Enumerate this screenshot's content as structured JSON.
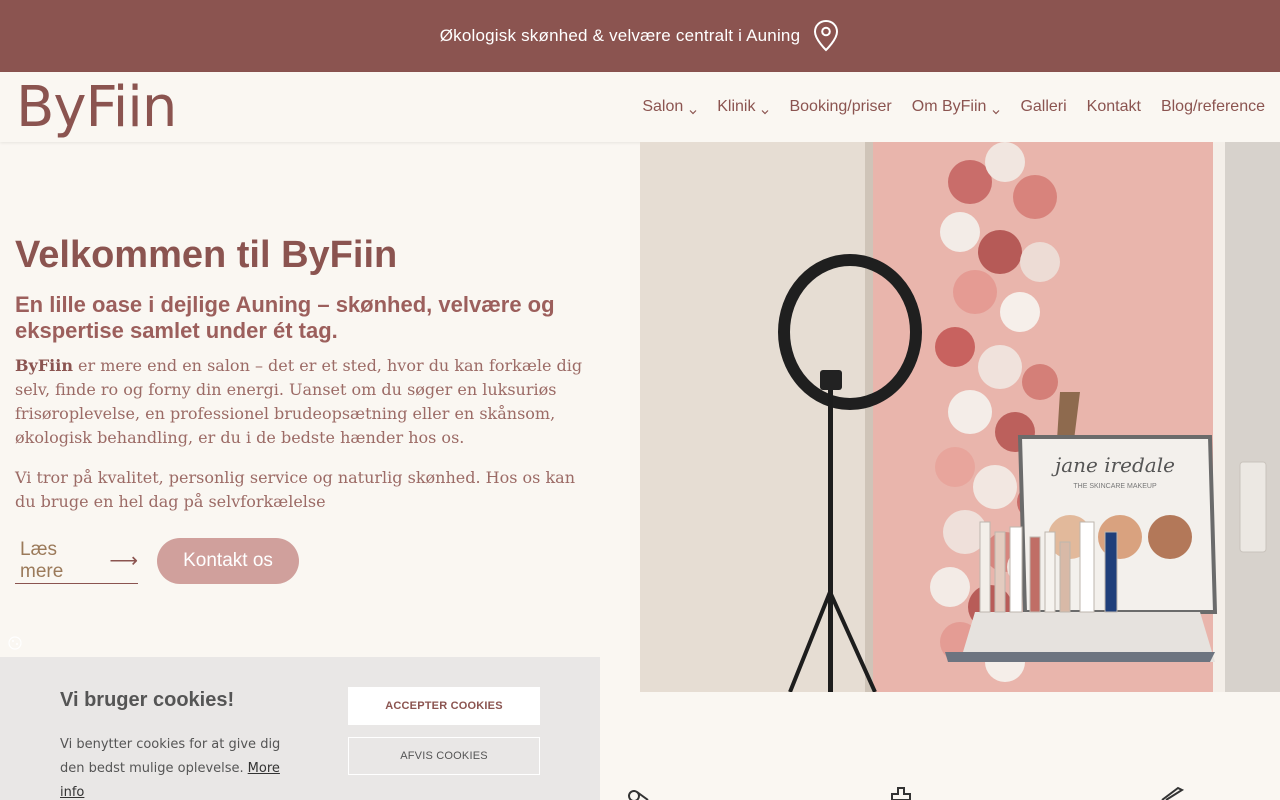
{
  "topbar": {
    "text": "Økologisk skønhed & velvære centralt i Auning",
    "icon": "map-pin-icon"
  },
  "header": {
    "logo": "ByFiin",
    "nav": [
      {
        "label": "Salon",
        "has_dropdown": true
      },
      {
        "label": "Klinik",
        "has_dropdown": true
      },
      {
        "label": "Booking/priser",
        "has_dropdown": false
      },
      {
        "label": "Om ByFiin",
        "has_dropdown": true
      },
      {
        "label": "Galleri",
        "has_dropdown": false
      },
      {
        "label": "Kontakt",
        "has_dropdown": false
      },
      {
        "label": "Blog/reference",
        "has_dropdown": false
      }
    ]
  },
  "hero": {
    "title": "Velkommen til ByFiin",
    "subtitle": "En lille oase i dejlige Auning – skønhed, velvære og ekspertise samlet under ét tag.",
    "p1_bold": "ByFiin",
    "p1_rest": " er mere end en salon – det er et sted, hvor du kan forkæle dig selv, finde ro og forny din energi. Uanset om du søger en luksuriøs frisøroplevelse, en professionel brudeopsætning eller en skånsom, økologisk behandling, er du i de bedste hænder hos os.",
    "p2": "Vi tror på kvalitet, personlig service og naturlig skønhed. Hos os kan du bruge en hel dag på selvforkælelse",
    "read_more": "Læs mere",
    "contact": "Kontakt os"
  },
  "hero_image": {
    "brand_sign": "jane iredale",
    "brand_sub": "THE SKINCARE MAKEUP"
  },
  "cookie": {
    "title": "Vi bruger cookies!",
    "text": "Vi benytter cookies for at give dig den bedst mulige oplevelse.",
    "link": "More info",
    "accept": "ACCEPTER COOKIES",
    "decline": "AFVIS COOKIES"
  },
  "colors": {
    "brand": "#8b5450",
    "accent_button": "#d0a09c",
    "background": "#faf7f2",
    "cookie_bg": "#e9e7e6"
  }
}
